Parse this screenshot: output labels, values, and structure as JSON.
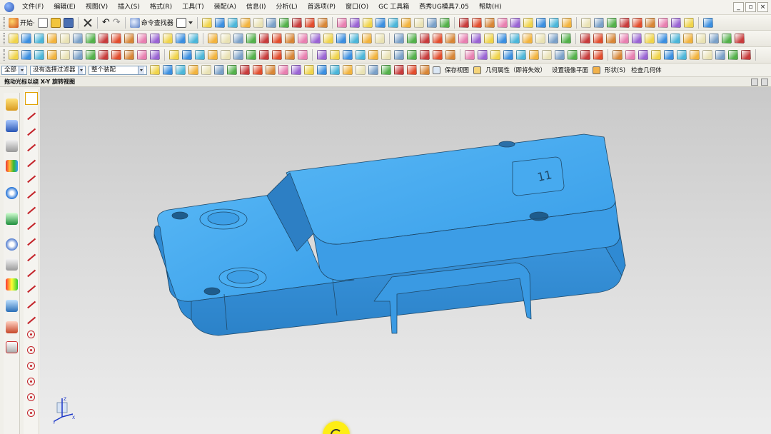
{
  "menubar": {
    "items": [
      "文件(F)",
      "编辑(E)",
      "视图(V)",
      "插入(S)",
      "格式(R)",
      "工具(T)",
      "装配(A)",
      "信息(I)",
      "分析(L)",
      "首选项(P)",
      "窗口(O)",
      "GC 工具箱",
      "燕秀UG模具7.05",
      "帮助(H)"
    ],
    "window_buttons": [
      "_",
      "▫",
      "×"
    ]
  },
  "toolbar1": {
    "start_label": "开始·",
    "command_finder_label": "命令查找器"
  },
  "selection_bar": {
    "scope_value": "全部",
    "filter_value": "没有选择过滤器",
    "assembly_value": "整个装配",
    "save_view_label": "保存视图",
    "geometry_props_label": "几何属性（即将失效）",
    "set_mirror_plane_label": "设置镜像平面",
    "shape_label": "形状(S)",
    "check_geometry_label": "检查几何体"
  },
  "status": {
    "cue_text": "拖动光标以绕 X-Y 旋转视图"
  },
  "viewport": {
    "part_label": "11",
    "triad_x": "X",
    "triad_y": "Y",
    "triad_z": "Z"
  },
  "colors": {
    "part_fill": "#42a7ef",
    "part_edge": "#1f4a6b",
    "cursor_highlight": "#ffee0a",
    "viewport_top": "#c9c9c9",
    "viewport_bottom": "#ededed"
  },
  "icons": {
    "toolbar1": [
      "new-icon",
      "open-icon",
      "save-icon",
      "close-icon",
      "undo-icon",
      "redo-icon",
      "command-finder-icon",
      "snap-view-icon"
    ],
    "cursor": "rotate-view-icon"
  }
}
